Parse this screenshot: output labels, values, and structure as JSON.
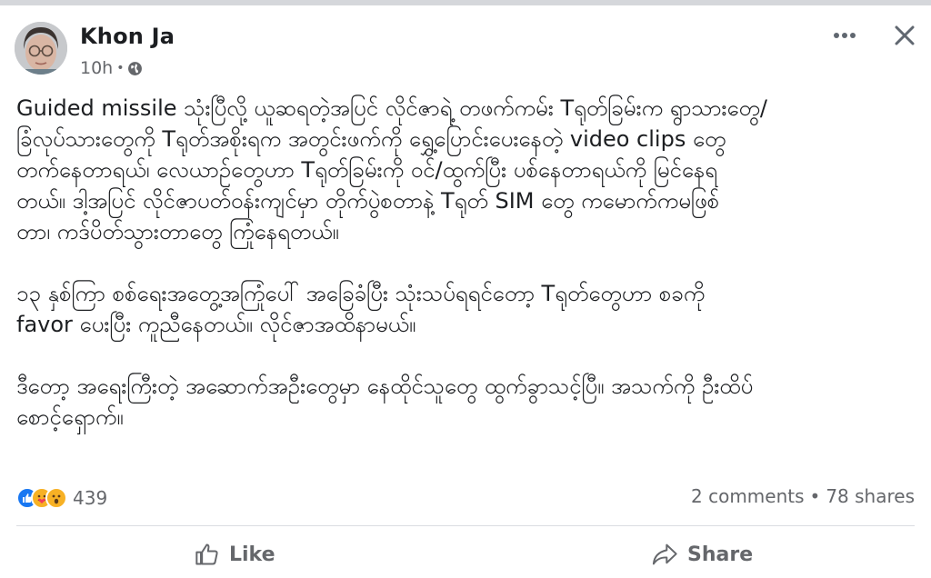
{
  "colors": {
    "text": "#1c1e21",
    "secondary": "#65676b",
    "like_blue": "#1877f2",
    "haha_yellow": "#f7b125",
    "divider": "#dadde1"
  },
  "post": {
    "author": "Khon Ja",
    "time": "10h",
    "audience_icon": "globe-icon",
    "paragraphs": [
      "Guided missile သုံးပြီလို့ ယူဆရတဲ့အပြင် လိုင်ဇာရဲ့ တဖက်ကမ်း Tရုတ်ခြမ်းက ရွာသားတွေ/\nခြံလုပ်သားတွေကို Tရုတ်အစိုးရက အတွင်းဖက်ကို ရွှေ့ပြောင်းပေးနေတဲ့ video clips တွေ\nတက်နေတာရယ်၊ လေယာဉ်တွေဟာ Tရုတ်ခြမ်းကို ဝင်/ထွက်ပြီး ပစ်နေတာရယ်ကို မြင်နေရ\nတယ်။ ဒါ့အပြင် လိုင်ဇာပတ်ဝန်းကျင်မှာ တိုက်ပွဲစတာနဲ့ Tရုတ် SIM တွေ ကမောက်ကမဖြစ်\nတာ၊ ကဒ်ပိတ်သွားတာတွေ ကြုံနေရတယ်။",
      "၁၃ နှစ်ကြာ စစ်ရေးအတွေ့အကြုံပေါ် အခြေခံပြီး သုံးသပ်ရရင်တော့ Tရုတ်တွေဟာ စခကို\nfavor ပေးပြီး ကူညီနေတယ်။ လိုင်ဇာအထိနာမယ်။",
      "ဒီတော့ အရေးကြီးတဲ့ အဆောက်အဦးတွေမှာ နေထိုင်သူတွေ ထွက်ခွာသင့်ပြီ။ အသက်ကို ဦးထိပ်\nစောင့်ရှောက်။"
    ],
    "reactions": {
      "icons": [
        "like-icon",
        "care-icon",
        "wow-icon"
      ],
      "count": "439"
    },
    "stats": {
      "comments": "2 comments",
      "separator": "•",
      "shares": "78 shares"
    },
    "actions": {
      "like": "Like",
      "share": "Share"
    }
  }
}
